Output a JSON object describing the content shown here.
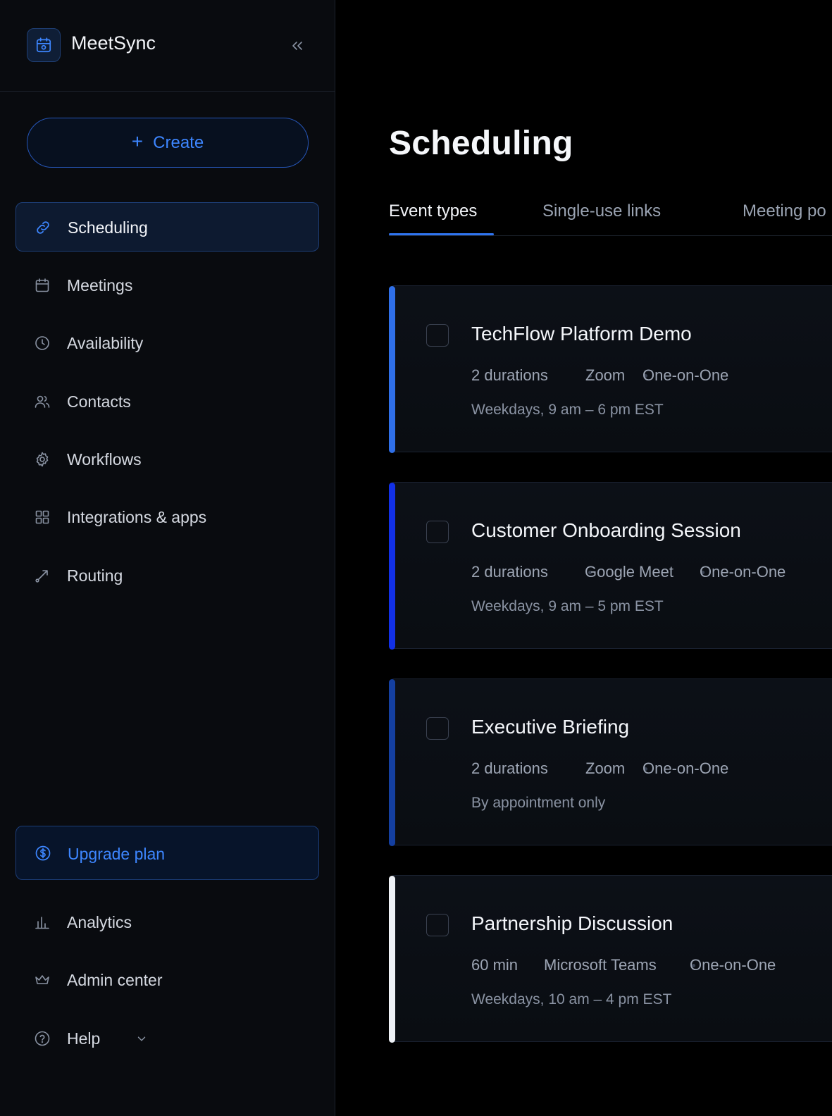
{
  "app": {
    "name": "MeetSync",
    "accent": "#3d86ff"
  },
  "sidebar": {
    "create_label": "Create",
    "items": [
      {
        "label": "Scheduling",
        "icon": "link-icon",
        "active": true
      },
      {
        "label": "Meetings",
        "icon": "calendar-icon"
      },
      {
        "label": "Availability",
        "icon": "clock-icon"
      },
      {
        "label": "Contacts",
        "icon": "users-icon"
      },
      {
        "label": "Workflows",
        "icon": "gear-icon"
      },
      {
        "label": "Integrations & apps",
        "icon": "grid-icon"
      },
      {
        "label": "Routing",
        "icon": "routing-icon"
      }
    ],
    "upgrade_label": "Upgrade plan",
    "bottom_items": [
      {
        "label": "Analytics",
        "icon": "bar-chart-icon"
      },
      {
        "label": "Admin center",
        "icon": "crown-icon"
      },
      {
        "label": "Help",
        "icon": "help-icon"
      }
    ]
  },
  "main": {
    "title": "Scheduling",
    "tabs": [
      {
        "label": "Event types",
        "active": true
      },
      {
        "label": "Single-use links"
      },
      {
        "label": "Meeting po"
      }
    ],
    "events": [
      {
        "title": "TechFlow Platform Demo",
        "duration": "2 durations",
        "location": "Zoom",
        "type": "One-on-One",
        "schedule": "Weekdays, 9 am – 6 pm EST",
        "color": "#2f6fe8"
      },
      {
        "title": "Customer Onboarding Session",
        "duration": "2 durations",
        "location": "Google Meet",
        "type": "One-on-One",
        "schedule": "Weekdays, 9 am – 5 pm EST",
        "color": "#1230e6"
      },
      {
        "title": "Executive Briefing",
        "duration": "2 durations",
        "location": "Zoom",
        "type": "One-on-One",
        "schedule": "By appointment only",
        "color": "#143fa0"
      },
      {
        "title": "Partnership Discussion",
        "duration": "60 min",
        "location": "Microsoft Teams",
        "type": "One-on-One",
        "schedule": "Weekdays, 10 am – 4 pm EST",
        "color": "#eef1f6"
      }
    ]
  }
}
